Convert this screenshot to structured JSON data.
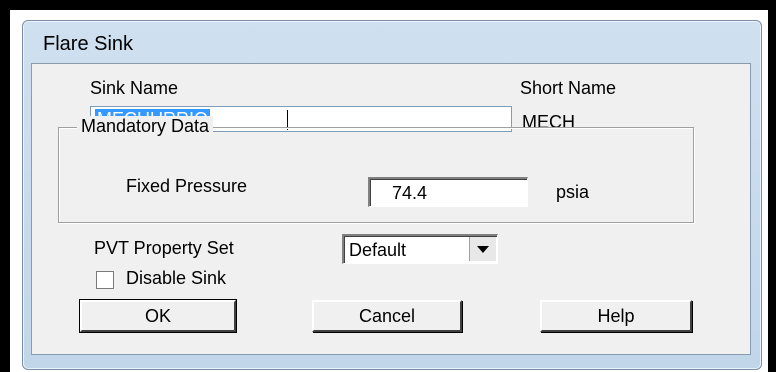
{
  "window": {
    "title": "Flare Sink"
  },
  "sink_name": {
    "label": "Sink Name",
    "value": "MECHURRIO"
  },
  "short_name": {
    "label": "Short Name",
    "value": "MECH"
  },
  "mandatory_data": {
    "group_label": "Mandatory Data",
    "fixed_pressure": {
      "label": "Fixed Pressure",
      "value": "74.4",
      "unit": "psia"
    }
  },
  "pvt": {
    "label": "PVT Property Set",
    "selected": "Default"
  },
  "disable_sink": {
    "label": "Disable Sink",
    "checked": false
  },
  "buttons": {
    "ok": "OK",
    "cancel": "Cancel",
    "help": "Help"
  },
  "colors": {
    "selection": "#3399ff",
    "dialog_bg": "#f0f0f0",
    "frame": "#c2d6ea"
  }
}
